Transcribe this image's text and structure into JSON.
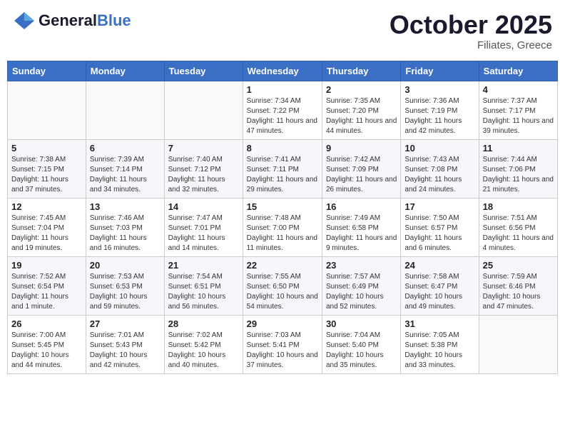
{
  "header": {
    "logo": {
      "general": "General",
      "blue": "Blue",
      "icon": "▶"
    },
    "title": "October 2025",
    "subtitle": "Filiates, Greece"
  },
  "weekdays": [
    "Sunday",
    "Monday",
    "Tuesday",
    "Wednesday",
    "Thursday",
    "Friday",
    "Saturday"
  ],
  "weeks": [
    [
      {
        "day": "",
        "info": ""
      },
      {
        "day": "",
        "info": ""
      },
      {
        "day": "",
        "info": ""
      },
      {
        "day": "1",
        "info": "Sunrise: 7:34 AM\nSunset: 7:22 PM\nDaylight: 11 hours and 47 minutes."
      },
      {
        "day": "2",
        "info": "Sunrise: 7:35 AM\nSunset: 7:20 PM\nDaylight: 11 hours and 44 minutes."
      },
      {
        "day": "3",
        "info": "Sunrise: 7:36 AM\nSunset: 7:19 PM\nDaylight: 11 hours and 42 minutes."
      },
      {
        "day": "4",
        "info": "Sunrise: 7:37 AM\nSunset: 7:17 PM\nDaylight: 11 hours and 39 minutes."
      }
    ],
    [
      {
        "day": "5",
        "info": "Sunrise: 7:38 AM\nSunset: 7:15 PM\nDaylight: 11 hours and 37 minutes."
      },
      {
        "day": "6",
        "info": "Sunrise: 7:39 AM\nSunset: 7:14 PM\nDaylight: 11 hours and 34 minutes."
      },
      {
        "day": "7",
        "info": "Sunrise: 7:40 AM\nSunset: 7:12 PM\nDaylight: 11 hours and 32 minutes."
      },
      {
        "day": "8",
        "info": "Sunrise: 7:41 AM\nSunset: 7:11 PM\nDaylight: 11 hours and 29 minutes."
      },
      {
        "day": "9",
        "info": "Sunrise: 7:42 AM\nSunset: 7:09 PM\nDaylight: 11 hours and 26 minutes."
      },
      {
        "day": "10",
        "info": "Sunrise: 7:43 AM\nSunset: 7:08 PM\nDaylight: 11 hours and 24 minutes."
      },
      {
        "day": "11",
        "info": "Sunrise: 7:44 AM\nSunset: 7:06 PM\nDaylight: 11 hours and 21 minutes."
      }
    ],
    [
      {
        "day": "12",
        "info": "Sunrise: 7:45 AM\nSunset: 7:04 PM\nDaylight: 11 hours and 19 minutes."
      },
      {
        "day": "13",
        "info": "Sunrise: 7:46 AM\nSunset: 7:03 PM\nDaylight: 11 hours and 16 minutes."
      },
      {
        "day": "14",
        "info": "Sunrise: 7:47 AM\nSunset: 7:01 PM\nDaylight: 11 hours and 14 minutes."
      },
      {
        "day": "15",
        "info": "Sunrise: 7:48 AM\nSunset: 7:00 PM\nDaylight: 11 hours and 11 minutes."
      },
      {
        "day": "16",
        "info": "Sunrise: 7:49 AM\nSunset: 6:58 PM\nDaylight: 11 hours and 9 minutes."
      },
      {
        "day": "17",
        "info": "Sunrise: 7:50 AM\nSunset: 6:57 PM\nDaylight: 11 hours and 6 minutes."
      },
      {
        "day": "18",
        "info": "Sunrise: 7:51 AM\nSunset: 6:56 PM\nDaylight: 11 hours and 4 minutes."
      }
    ],
    [
      {
        "day": "19",
        "info": "Sunrise: 7:52 AM\nSunset: 6:54 PM\nDaylight: 11 hours and 1 minute."
      },
      {
        "day": "20",
        "info": "Sunrise: 7:53 AM\nSunset: 6:53 PM\nDaylight: 10 hours and 59 minutes."
      },
      {
        "day": "21",
        "info": "Sunrise: 7:54 AM\nSunset: 6:51 PM\nDaylight: 10 hours and 56 minutes."
      },
      {
        "day": "22",
        "info": "Sunrise: 7:55 AM\nSunset: 6:50 PM\nDaylight: 10 hours and 54 minutes."
      },
      {
        "day": "23",
        "info": "Sunrise: 7:57 AM\nSunset: 6:49 PM\nDaylight: 10 hours and 52 minutes."
      },
      {
        "day": "24",
        "info": "Sunrise: 7:58 AM\nSunset: 6:47 PM\nDaylight: 10 hours and 49 minutes."
      },
      {
        "day": "25",
        "info": "Sunrise: 7:59 AM\nSunset: 6:46 PM\nDaylight: 10 hours and 47 minutes."
      }
    ],
    [
      {
        "day": "26",
        "info": "Sunrise: 7:00 AM\nSunset: 5:45 PM\nDaylight: 10 hours and 44 minutes."
      },
      {
        "day": "27",
        "info": "Sunrise: 7:01 AM\nSunset: 5:43 PM\nDaylight: 10 hours and 42 minutes."
      },
      {
        "day": "28",
        "info": "Sunrise: 7:02 AM\nSunset: 5:42 PM\nDaylight: 10 hours and 40 minutes."
      },
      {
        "day": "29",
        "info": "Sunrise: 7:03 AM\nSunset: 5:41 PM\nDaylight: 10 hours and 37 minutes."
      },
      {
        "day": "30",
        "info": "Sunrise: 7:04 AM\nSunset: 5:40 PM\nDaylight: 10 hours and 35 minutes."
      },
      {
        "day": "31",
        "info": "Sunrise: 7:05 AM\nSunset: 5:38 PM\nDaylight: 10 hours and 33 minutes."
      },
      {
        "day": "",
        "info": ""
      }
    ]
  ]
}
